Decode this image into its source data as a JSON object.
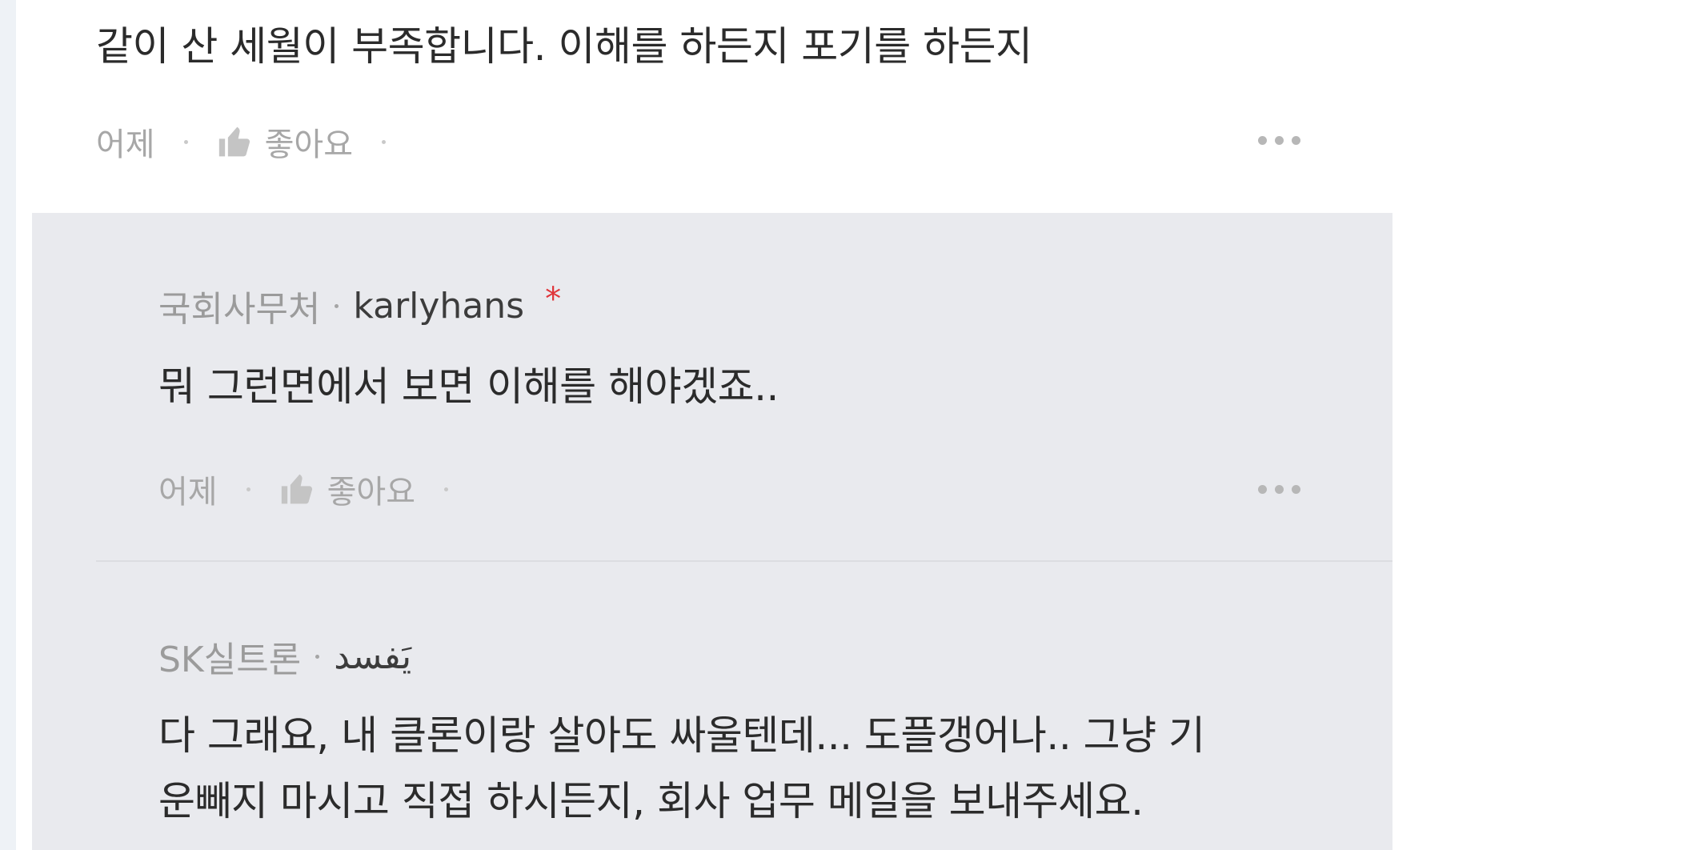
{
  "main_comment": {
    "text": "같이 산 세월이 부족합니다. 이해를 하든지 포기를 하든지",
    "time": "어제",
    "like_label": "좋아요"
  },
  "replies": [
    {
      "org": "국회사무처",
      "nickname": "karlyhans",
      "author_badge": "*",
      "lines": [
        "뭐 그런면에서 보면 이해를 해야겠죠.."
      ],
      "time": "어제",
      "like_label": "좋아요"
    },
    {
      "org": "SK실트론",
      "nickname": "يَفسد",
      "lines": [
        "다 그래요, 내 클론이랑 살아도 싸울텐데... 도플갱어나.. 그냥 기",
        "운빼지 마시고 직접 하시든지, 회사 업무 메일을 보내주세요."
      ]
    }
  ],
  "icons": {
    "like": "thumbs-up-icon",
    "more": "more-horizontal-icon"
  },
  "colors": {
    "reply_background": "#e9eaee",
    "author_badge": "#e0353a",
    "meta_text": "#a7a7a7"
  }
}
